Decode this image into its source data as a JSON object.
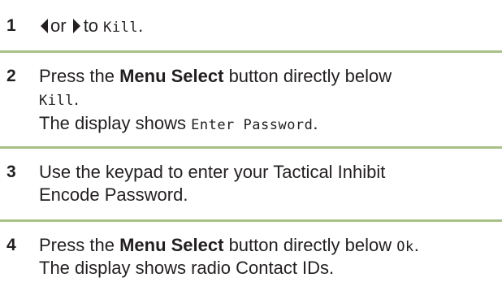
{
  "steps": [
    {
      "number": "1",
      "or_text": "or",
      "to_text": "to",
      "display_word": "Kill",
      "period": "."
    },
    {
      "number": "2",
      "press_text": "Press the",
      "button_name": "Menu Select",
      "after_button": "button directly below",
      "display_word": "Kill",
      "period": ".",
      "result_text": "The display shows",
      "result_display": "Enter Password",
      "result_period": "."
    },
    {
      "number": "3",
      "line1": "Use the keypad to enter your Tactical Inhibit",
      "line2": "Encode Password."
    },
    {
      "number": "4",
      "press_text": "Press the",
      "button_name": "Menu Select",
      "after_button": "button directly below",
      "display_word": "Ok",
      "period": ".",
      "result_text": "The display shows radio Contact IDs."
    }
  ],
  "colors": {
    "rule": "#a8c186",
    "text": "#231f20"
  },
  "icons": {
    "left": "left-triangle-icon",
    "right": "right-triangle-icon"
  }
}
